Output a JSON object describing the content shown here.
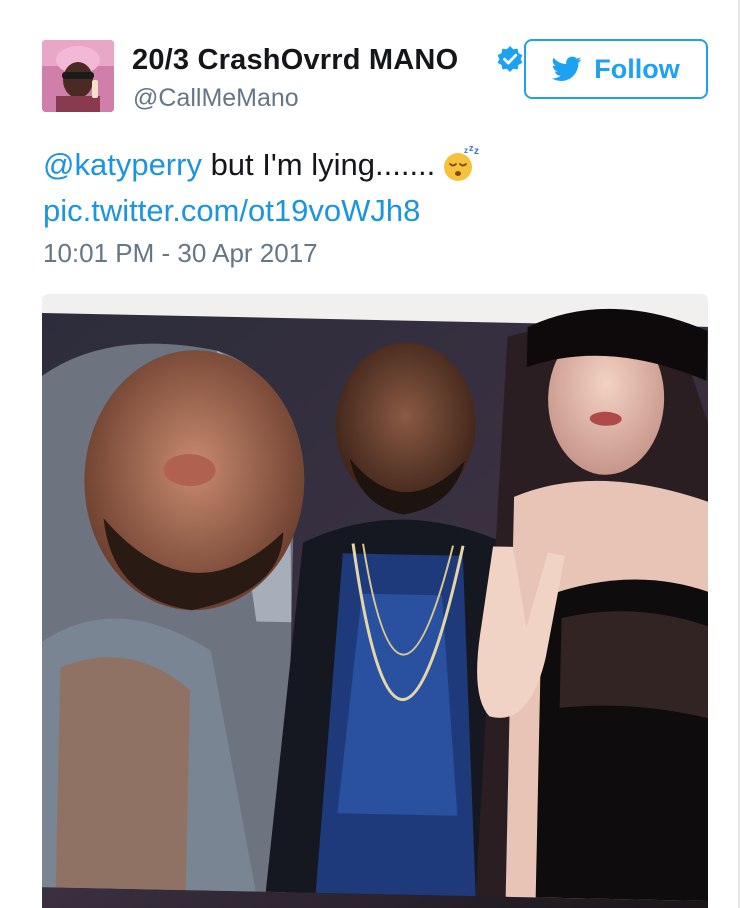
{
  "tweet": {
    "display_name": "20/3 CrashOvrrd MANO",
    "handle": "@CallMeMano",
    "follow_label": "Follow",
    "mention": "@katyperry",
    "text": " but I'm lying.......",
    "emoji": "sleeping-face-emoji",
    "pic_link": "pic.twitter.com/ot19voWJh8",
    "timestamp": "10:01 PM - 30 Apr 2017"
  },
  "colors": {
    "accent": "#1da1f2",
    "link": "#1b95e0",
    "muted": "#657786",
    "text": "#14171a"
  },
  "icons": {
    "verified": "verified-badge-icon",
    "follow": "twitter-bird-icon"
  }
}
